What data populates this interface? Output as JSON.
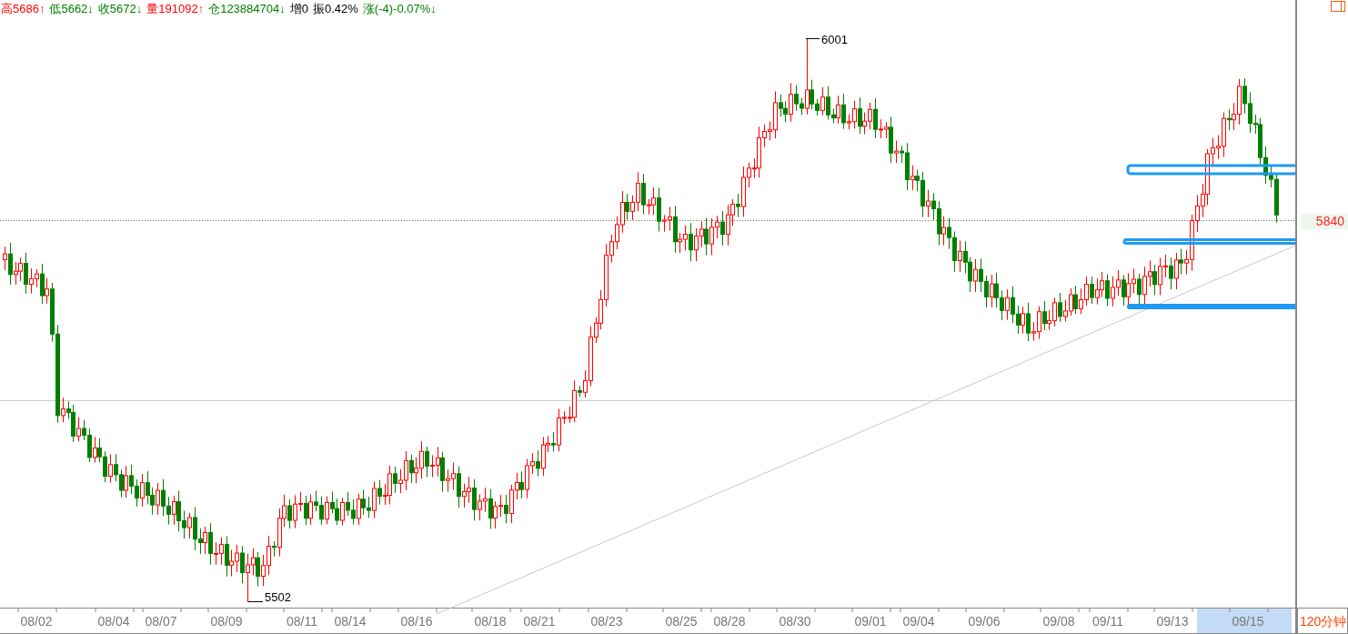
{
  "header_stats": [
    {
      "label": "高",
      "value": "5686",
      "arrow": "↑",
      "color": "#ff0000"
    },
    {
      "label": "低",
      "value": "5662",
      "arrow": "↓",
      "color": "#008000"
    },
    {
      "label": "收",
      "value": "5672",
      "arrow": "↓",
      "color": "#008000"
    },
    {
      "label": "量",
      "value": "191092",
      "arrow": "↑",
      "color": "#ff0000"
    },
    {
      "label": "仓",
      "value": "123884704",
      "arrow": "↓",
      "color": "#008000"
    },
    {
      "label": "增",
      "value": "0"
    },
    {
      "label": "振",
      "value": "0.42%"
    },
    {
      "label": "涨",
      "value": "(-4)-0.07%",
      "arrow": "↓",
      "color": "#008000"
    }
  ],
  "chart": {
    "high_label": "6001",
    "low_label": "5502",
    "price_tag": "5840"
  },
  "x_axis": [
    {
      "label": "08/02",
      "selected": false
    },
    {
      "label": "08/04",
      "selected": false
    },
    {
      "label": "08/07",
      "selected": false
    },
    {
      "label": "08/09",
      "selected": false
    },
    {
      "label": "08/11",
      "selected": false
    },
    {
      "label": "08/14",
      "selected": false
    },
    {
      "label": "08/16",
      "selected": false
    },
    {
      "label": "08/18",
      "selected": false
    },
    {
      "label": "08/21",
      "selected": false
    },
    {
      "label": "08/23",
      "selected": false
    },
    {
      "label": "08/25",
      "selected": false
    },
    {
      "label": "08/28",
      "selected": false
    },
    {
      "label": "08/30",
      "selected": false
    },
    {
      "label": "09/01",
      "selected": false
    },
    {
      "label": "09/04",
      "selected": false
    },
    {
      "label": "09/06",
      "selected": false
    },
    {
      "label": "09/08",
      "selected": false
    },
    {
      "label": "09/11",
      "selected": false
    },
    {
      "label": "09/13",
      "selected": false
    },
    {
      "label": "09/15",
      "selected": true
    }
  ],
  "period": "120分钟"
}
